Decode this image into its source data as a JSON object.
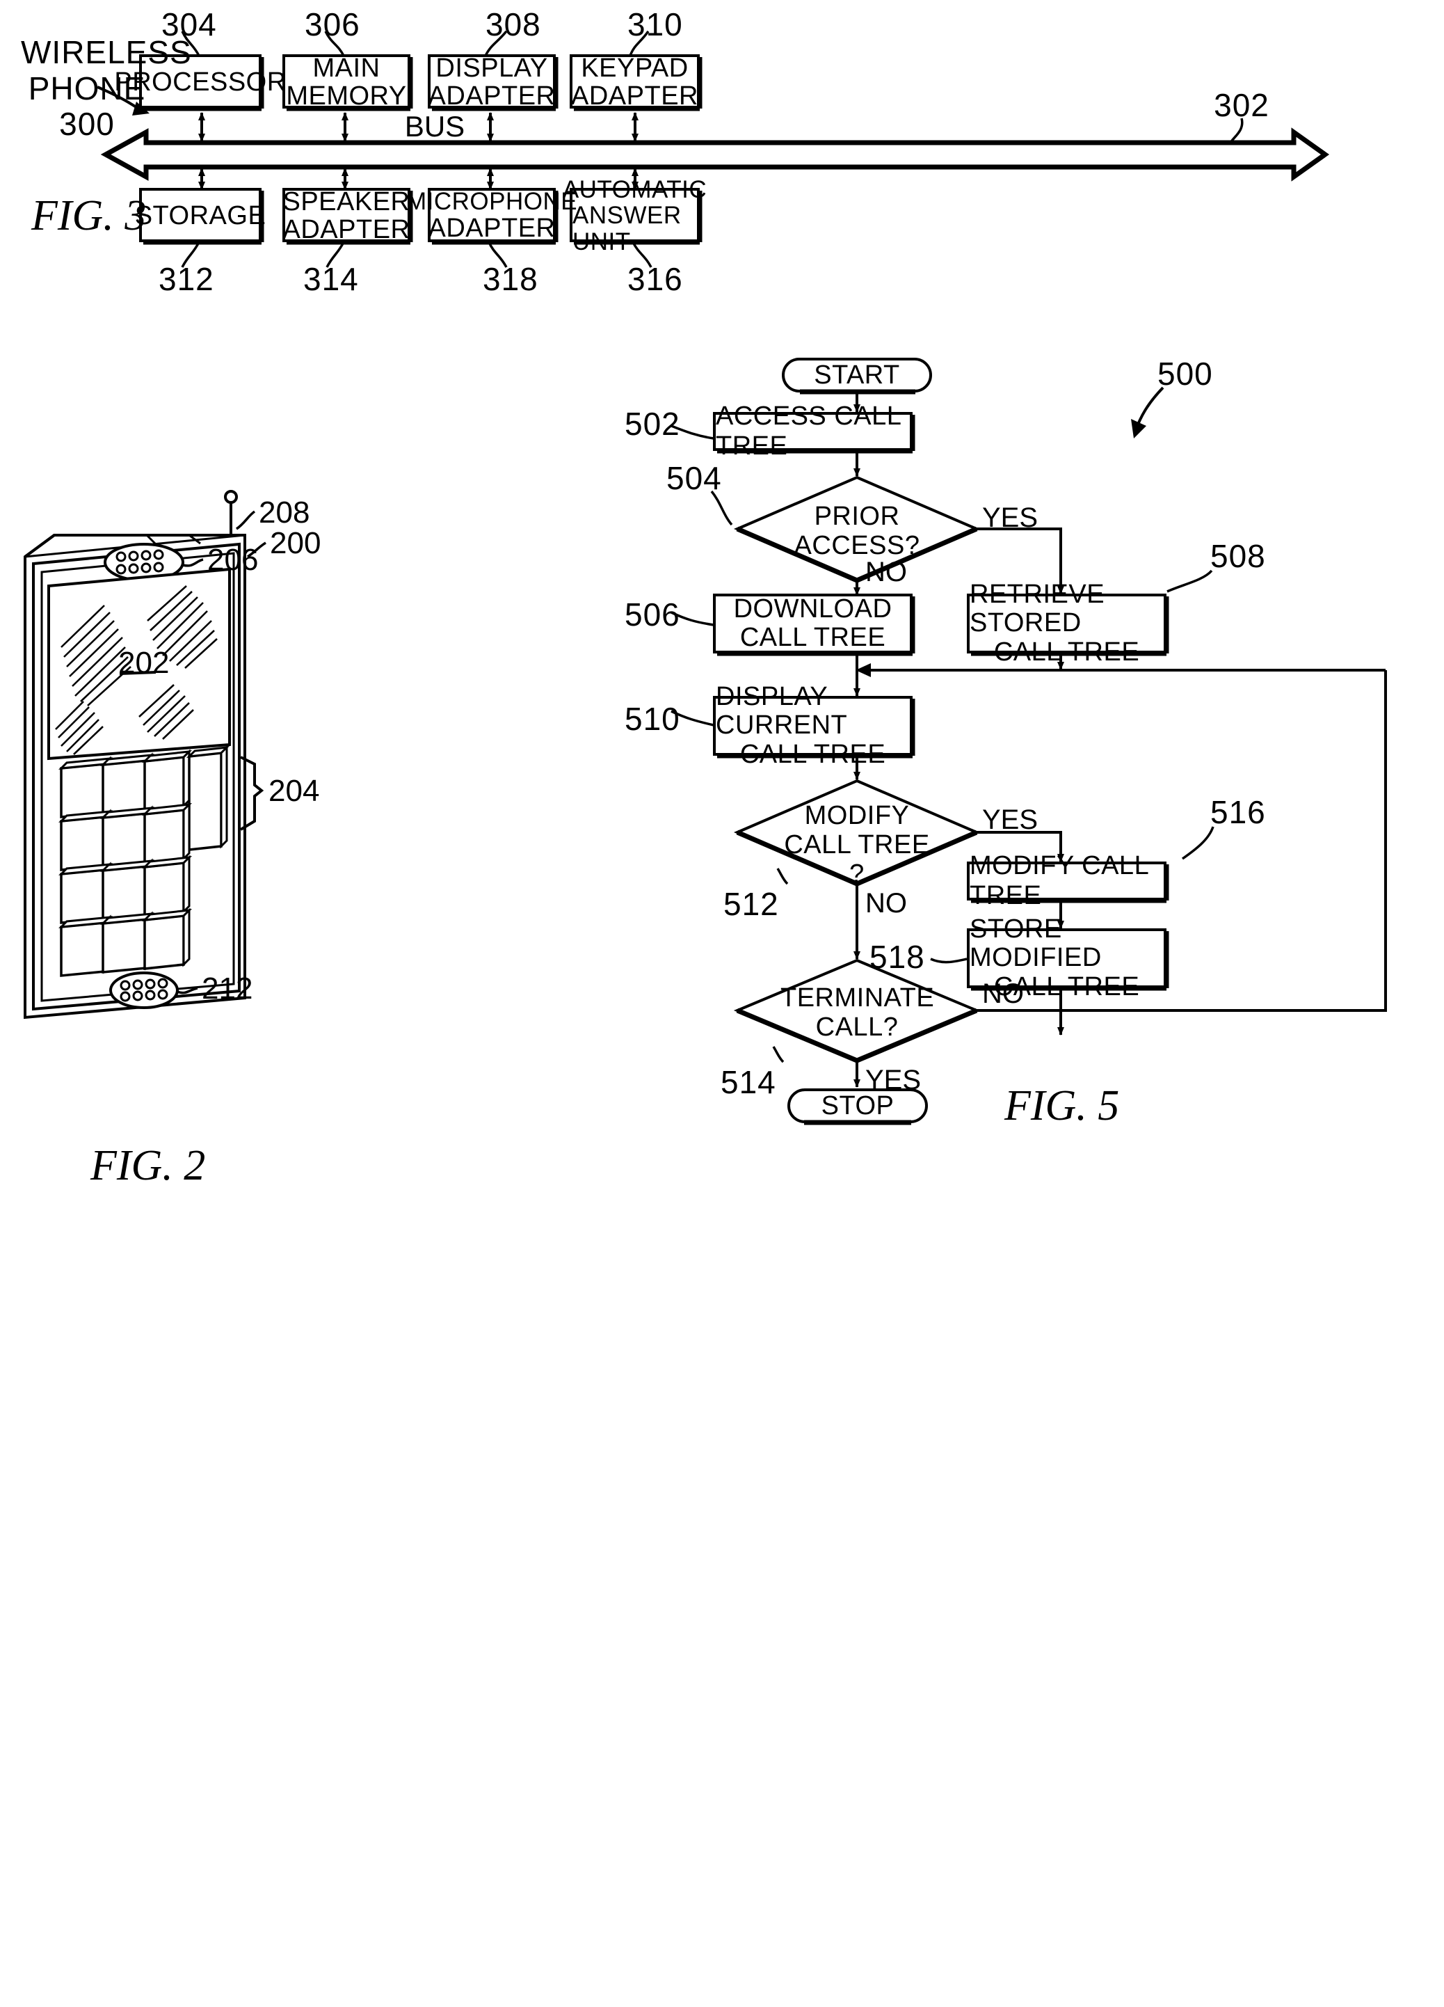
{
  "sheet": {
    "background_color": "#ffffff",
    "ink_color": "#000000"
  },
  "fig3": {
    "title": "FIG. 3",
    "system_label_line1": "WIRELESS",
    "system_label_line2": "PHONE",
    "system_ref": "300",
    "bus_label": "BUS",
    "bus_ref": "302",
    "top_row": [
      {
        "ref": "304",
        "line1": "PROCESSOR",
        "line2": ""
      },
      {
        "ref": "306",
        "line1": "MAIN",
        "line2": "MEMORY"
      },
      {
        "ref": "308",
        "line1": "DISPLAY",
        "line2": "ADAPTER"
      },
      {
        "ref": "310",
        "line1": "KEYPAD",
        "line2": "ADAPTER"
      }
    ],
    "bottom_row": [
      {
        "ref": "312",
        "line1": "STORAGE",
        "line2": ""
      },
      {
        "ref": "314",
        "line1": "SPEAKER",
        "line2": "ADAPTER"
      },
      {
        "ref": "318",
        "line1": "MICROPHONE",
        "line2": "ADAPTER"
      },
      {
        "ref": "316",
        "line1": "AUTOMATIC",
        "line2": "ANSWER UNIT"
      }
    ]
  },
  "fig2": {
    "title": "FIG. 2",
    "refs": {
      "antenna": "208",
      "body": "200",
      "speaker": "206",
      "display": "202",
      "keypad": "204",
      "microphone": "212"
    }
  },
  "fig5": {
    "title": "FIG. 5",
    "flow_ref": "500",
    "terminals": {
      "start": "START",
      "stop": "STOP"
    },
    "nodes": [
      {
        "ref": "502",
        "kind": "process",
        "line1": "ACCESS CALL TREE",
        "line2": ""
      },
      {
        "ref": "504",
        "kind": "decision",
        "line1": "PRIOR",
        "line2": "ACCESS?",
        "line3": ""
      },
      {
        "ref": "506",
        "kind": "process",
        "line1": "DOWNLOAD",
        "line2": "CALL TREE"
      },
      {
        "ref": "508",
        "kind": "process",
        "line1": "RETRIEVE STORED",
        "line2": "CALL TREE"
      },
      {
        "ref": "510",
        "kind": "process",
        "line1": "DISPLAY CURRENT",
        "line2": "CALL TREE"
      },
      {
        "ref": "512",
        "kind": "decision",
        "line1": "MODIFY",
        "line2": "CALL TREE",
        "line3": "?"
      },
      {
        "ref": "516",
        "kind": "process",
        "line1": "MODIFY CALL TREE",
        "line2": ""
      },
      {
        "ref": "518",
        "kind": "process",
        "line1": "STORE MODIFIED",
        "line2": "CALL TREE"
      },
      {
        "ref": "514",
        "kind": "decision",
        "line1": "TERMINATE",
        "line2": "CALL?",
        "line3": ""
      }
    ],
    "edge_labels": {
      "prior_access_yes": "YES",
      "prior_access_no": "NO",
      "modify_yes": "YES",
      "modify_no": "NO",
      "terminate_no": "NO",
      "terminate_yes": "YES"
    }
  }
}
